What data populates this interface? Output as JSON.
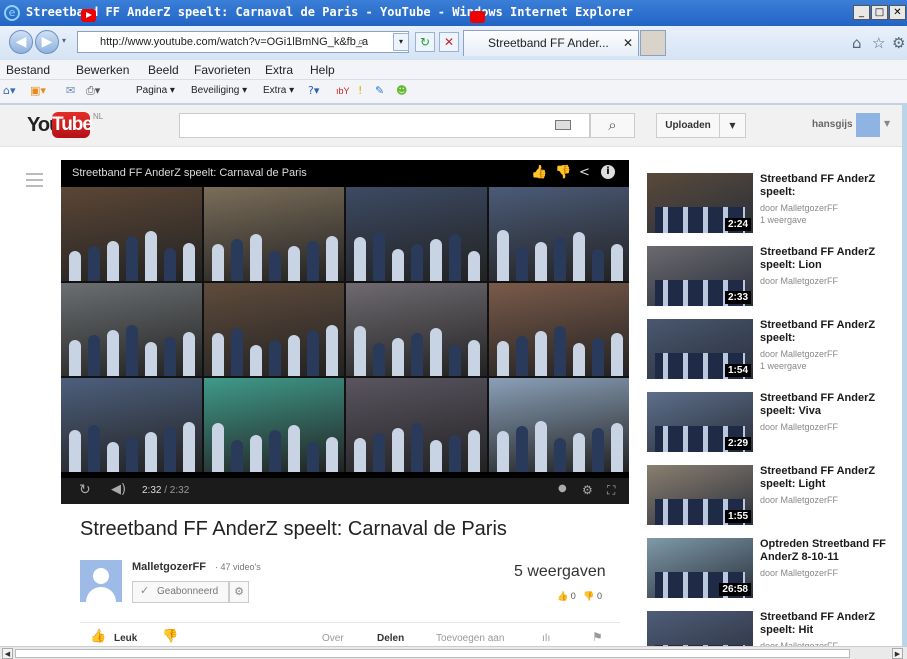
{
  "window": {
    "title": "Streetband FF AnderZ speelt: Carnaval de Paris - YouTube - Windows Internet Explorer",
    "min_icon": "_",
    "max_icon": "□",
    "close_icon": "✕"
  },
  "address": {
    "url": "http://www.youtube.com/watch?v=OGi1lBmNG_k&fb_a",
    "tab_title": "Streetband FF Ander...",
    "tab_close": "✕"
  },
  "menu": [
    "Bestand",
    "Bewerken",
    "Beeld",
    "Favorieten",
    "Extra",
    "Help"
  ],
  "commands": [
    "Pagina ▾",
    "Beveiliging ▾",
    "Extra ▾"
  ],
  "yt": {
    "logo_you": "You",
    "logo_tube": "Tube",
    "logo_region": "NL",
    "upload_label": "Uploaden",
    "username": "hansgijs"
  },
  "player": {
    "title": "Streetband FF AnderZ speelt: Carnaval de Paris",
    "time_current": "2:32",
    "time_duration": "/ 2:32",
    "progress": 1.0
  },
  "video": {
    "title": "Streetband FF AnderZ speelt: Carnaval de Paris",
    "owner": "MalletgozerFF",
    "owner_videos": "· 47 video's",
    "subscribe_label": "Geabonneerd",
    "views": "5 weergaven",
    "likes": "0",
    "dislikes": "0"
  },
  "actions": {
    "like": "Leuk",
    "about": "Over",
    "share": "Delen",
    "add_to": "Toevoegen aan"
  },
  "related": [
    {
      "title": "Streetband FF AnderZ speelt:",
      "by": "door MalletgozerFF",
      "views": "1 weergave",
      "duration": "2:24"
    },
    {
      "title": "Streetband FF AnderZ speelt: Lion",
      "by": "door MalletgozerFF",
      "views": "",
      "duration": "2:33"
    },
    {
      "title": "Streetband FF AnderZ speelt:",
      "by": "door MalletgozerFF",
      "views": "1 weergave",
      "duration": "1:54"
    },
    {
      "title": "Streetband FF AnderZ speelt: Viva",
      "by": "door MalletgozerFF",
      "views": "",
      "duration": "2:29"
    },
    {
      "title": "Streetband FF AnderZ speelt: Light",
      "by": "door MalletgozerFF",
      "views": "",
      "duration": "1:55"
    },
    {
      "title": "Optreden Streetband FF AnderZ 8-10-11",
      "by": "door MalletgozerFF",
      "views": "",
      "duration": "26:58"
    },
    {
      "title": "Streetband FF AnderZ speelt: Hit",
      "by": "door MalletgozerFF",
      "views": "",
      "duration": ""
    }
  ]
}
